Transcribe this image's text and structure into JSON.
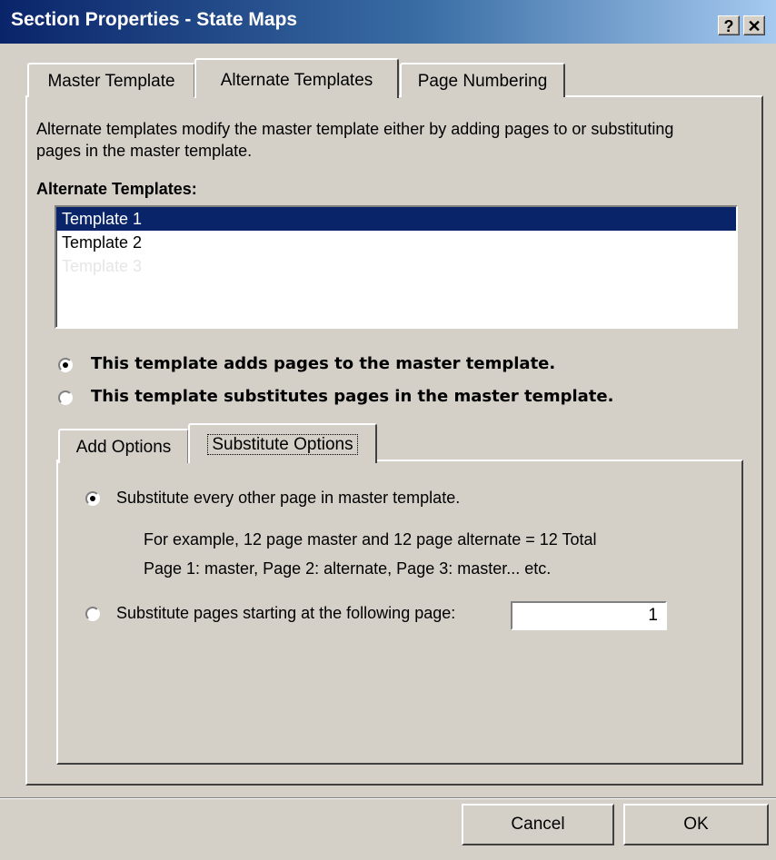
{
  "window": {
    "title": "Section Properties - State Maps",
    "help_label": "?",
    "close_label": "✕"
  },
  "tabs": [
    {
      "label": "Master Template",
      "active": false
    },
    {
      "label": "Alternate Templates",
      "active": true
    },
    {
      "label": "Page Numbering",
      "active": false
    }
  ],
  "description": "Alternate templates modify the master template either by adding pages to or substituting pages in the master template.",
  "alternate_templates": {
    "label": "Alternate Templates:",
    "items": [
      "Template 1",
      "Template 2",
      "Template 3"
    ],
    "selected_index": 0
  },
  "mode": {
    "adds_label": "This template adds pages to the master template.",
    "substitutes_label": "This template substitutes pages in the master template.",
    "selected": "adds"
  },
  "subtabs": [
    {
      "label": "Add Options",
      "active": false
    },
    {
      "label": "Substitute Options",
      "active": true
    }
  ],
  "substitute_options": {
    "every_other_label": "Substitute every other page in master template.",
    "example_line1": "For example, 12 page master and 12 page alternate = 12 Total",
    "example_line2": "Page 1: master, Page 2: alternate, Page 3: master... etc.",
    "starting_label": "Substitute pages starting at the following page:",
    "starting_value": "1",
    "selected": "every_other"
  },
  "buttons": {
    "cancel": "Cancel",
    "ok": "OK"
  }
}
